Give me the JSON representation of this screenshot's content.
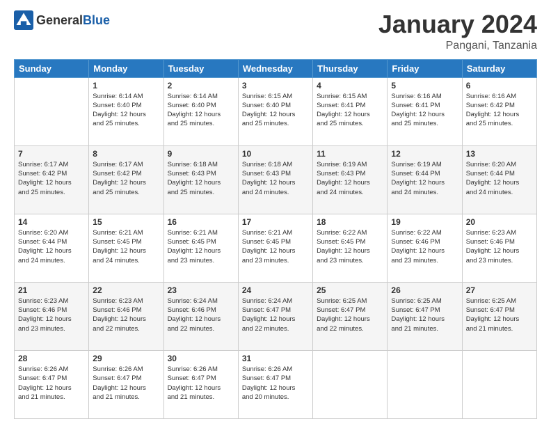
{
  "logo": {
    "general": "General",
    "blue": "Blue"
  },
  "title": "January 2024",
  "location": "Pangani, Tanzania",
  "days_header": [
    "Sunday",
    "Monday",
    "Tuesday",
    "Wednesday",
    "Thursday",
    "Friday",
    "Saturday"
  ],
  "weeks": [
    [
      {
        "day": "",
        "info": ""
      },
      {
        "day": "1",
        "info": "Sunrise: 6:14 AM\nSunset: 6:40 PM\nDaylight: 12 hours\nand 25 minutes."
      },
      {
        "day": "2",
        "info": "Sunrise: 6:14 AM\nSunset: 6:40 PM\nDaylight: 12 hours\nand 25 minutes."
      },
      {
        "day": "3",
        "info": "Sunrise: 6:15 AM\nSunset: 6:40 PM\nDaylight: 12 hours\nand 25 minutes."
      },
      {
        "day": "4",
        "info": "Sunrise: 6:15 AM\nSunset: 6:41 PM\nDaylight: 12 hours\nand 25 minutes."
      },
      {
        "day": "5",
        "info": "Sunrise: 6:16 AM\nSunset: 6:41 PM\nDaylight: 12 hours\nand 25 minutes."
      },
      {
        "day": "6",
        "info": "Sunrise: 6:16 AM\nSunset: 6:42 PM\nDaylight: 12 hours\nand 25 minutes."
      }
    ],
    [
      {
        "day": "7",
        "info": "Sunrise: 6:17 AM\nSunset: 6:42 PM\nDaylight: 12 hours\nand 25 minutes."
      },
      {
        "day": "8",
        "info": "Sunrise: 6:17 AM\nSunset: 6:42 PM\nDaylight: 12 hours\nand 25 minutes."
      },
      {
        "day": "9",
        "info": "Sunrise: 6:18 AM\nSunset: 6:43 PM\nDaylight: 12 hours\nand 25 minutes."
      },
      {
        "day": "10",
        "info": "Sunrise: 6:18 AM\nSunset: 6:43 PM\nDaylight: 12 hours\nand 24 minutes."
      },
      {
        "day": "11",
        "info": "Sunrise: 6:19 AM\nSunset: 6:43 PM\nDaylight: 12 hours\nand 24 minutes."
      },
      {
        "day": "12",
        "info": "Sunrise: 6:19 AM\nSunset: 6:44 PM\nDaylight: 12 hours\nand 24 minutes."
      },
      {
        "day": "13",
        "info": "Sunrise: 6:20 AM\nSunset: 6:44 PM\nDaylight: 12 hours\nand 24 minutes."
      }
    ],
    [
      {
        "day": "14",
        "info": "Sunrise: 6:20 AM\nSunset: 6:44 PM\nDaylight: 12 hours\nand 24 minutes."
      },
      {
        "day": "15",
        "info": "Sunrise: 6:21 AM\nSunset: 6:45 PM\nDaylight: 12 hours\nand 24 minutes."
      },
      {
        "day": "16",
        "info": "Sunrise: 6:21 AM\nSunset: 6:45 PM\nDaylight: 12 hours\nand 23 minutes."
      },
      {
        "day": "17",
        "info": "Sunrise: 6:21 AM\nSunset: 6:45 PM\nDaylight: 12 hours\nand 23 minutes."
      },
      {
        "day": "18",
        "info": "Sunrise: 6:22 AM\nSunset: 6:45 PM\nDaylight: 12 hours\nand 23 minutes."
      },
      {
        "day": "19",
        "info": "Sunrise: 6:22 AM\nSunset: 6:46 PM\nDaylight: 12 hours\nand 23 minutes."
      },
      {
        "day": "20",
        "info": "Sunrise: 6:23 AM\nSunset: 6:46 PM\nDaylight: 12 hours\nand 23 minutes."
      }
    ],
    [
      {
        "day": "21",
        "info": "Sunrise: 6:23 AM\nSunset: 6:46 PM\nDaylight: 12 hours\nand 23 minutes."
      },
      {
        "day": "22",
        "info": "Sunrise: 6:23 AM\nSunset: 6:46 PM\nDaylight: 12 hours\nand 22 minutes."
      },
      {
        "day": "23",
        "info": "Sunrise: 6:24 AM\nSunset: 6:46 PM\nDaylight: 12 hours\nand 22 minutes."
      },
      {
        "day": "24",
        "info": "Sunrise: 6:24 AM\nSunset: 6:47 PM\nDaylight: 12 hours\nand 22 minutes."
      },
      {
        "day": "25",
        "info": "Sunrise: 6:25 AM\nSunset: 6:47 PM\nDaylight: 12 hours\nand 22 minutes."
      },
      {
        "day": "26",
        "info": "Sunrise: 6:25 AM\nSunset: 6:47 PM\nDaylight: 12 hours\nand 21 minutes."
      },
      {
        "day": "27",
        "info": "Sunrise: 6:25 AM\nSunset: 6:47 PM\nDaylight: 12 hours\nand 21 minutes."
      }
    ],
    [
      {
        "day": "28",
        "info": "Sunrise: 6:26 AM\nSunset: 6:47 PM\nDaylight: 12 hours\nand 21 minutes."
      },
      {
        "day": "29",
        "info": "Sunrise: 6:26 AM\nSunset: 6:47 PM\nDaylight: 12 hours\nand 21 minutes."
      },
      {
        "day": "30",
        "info": "Sunrise: 6:26 AM\nSunset: 6:47 PM\nDaylight: 12 hours\nand 21 minutes."
      },
      {
        "day": "31",
        "info": "Sunrise: 6:26 AM\nSunset: 6:47 PM\nDaylight: 12 hours\nand 20 minutes."
      },
      {
        "day": "",
        "info": ""
      },
      {
        "day": "",
        "info": ""
      },
      {
        "day": "",
        "info": ""
      }
    ]
  ]
}
